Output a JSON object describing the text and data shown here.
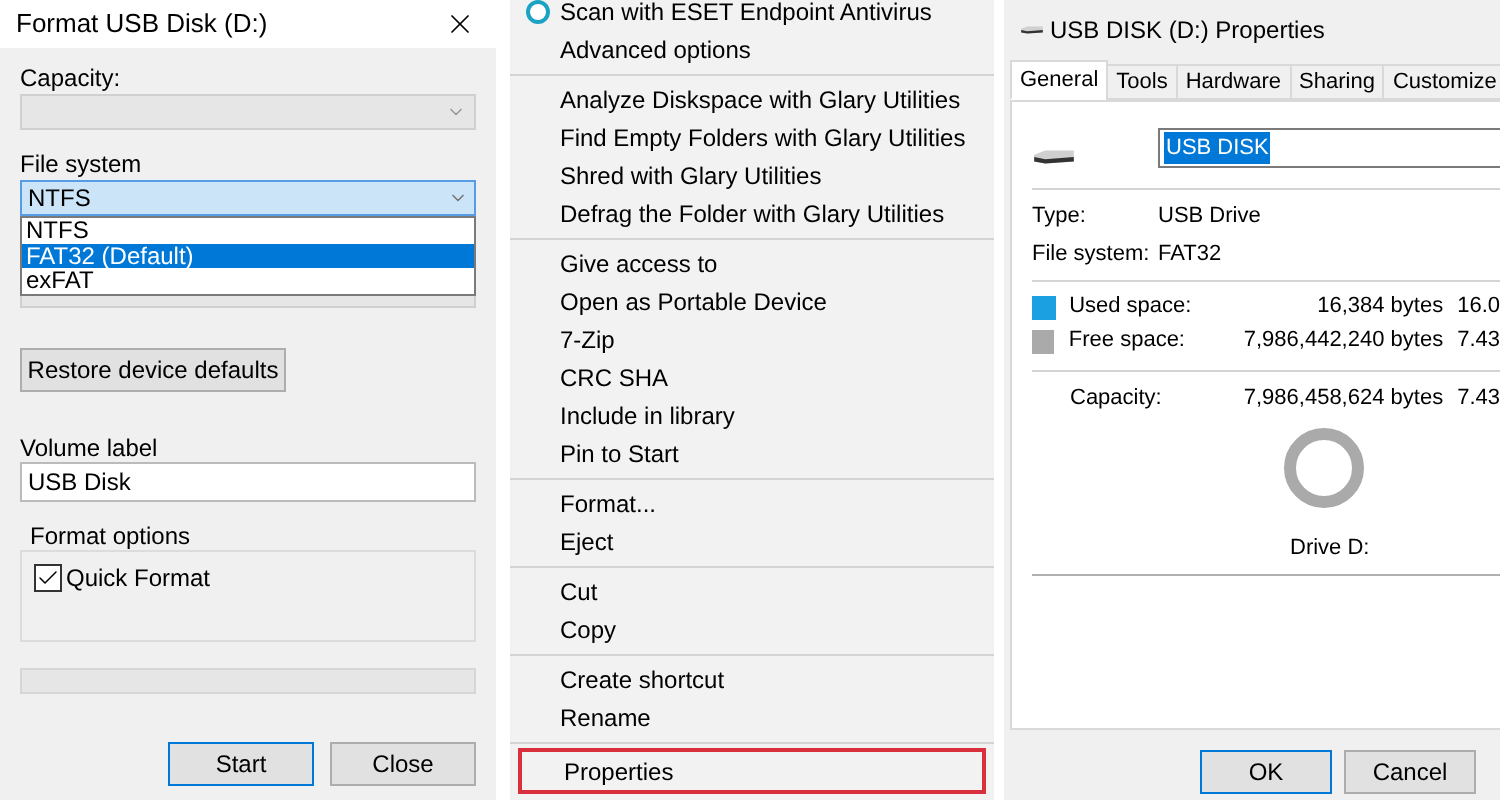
{
  "format_dialog": {
    "title": "Format USB Disk (D:)",
    "capacity_label": "Capacity:",
    "file_system_label": "File system",
    "file_system_value": "NTFS",
    "file_system_expanded": true,
    "file_system_options": [
      {
        "label": "NTFS",
        "selected": false
      },
      {
        "label": "FAT32 (Default)",
        "selected": true
      },
      {
        "label": "exFAT",
        "selected": false
      }
    ],
    "restore_button": "Restore device defaults",
    "volume_label_label": "Volume label",
    "volume_label_value": "USB Disk",
    "format_options_title": "Format options",
    "quick_format": {
      "label": "Quick Format",
      "checked": true
    },
    "progress": {
      "level": 0
    },
    "buttons": [
      {
        "label": "Start",
        "default": true
      },
      {
        "label": "Close",
        "default": false
      }
    ]
  },
  "context_menu": {
    "groups": [
      [
        {
          "label": "Scan with ESET Endpoint Antivirus",
          "icon": true,
          "selected": false
        },
        {
          "label": "Advanced options",
          "icon": false,
          "selected": false
        }
      ],
      [
        {
          "label": "Analyze Diskspace with Glary Utilities",
          "icon": false,
          "selected": false
        },
        {
          "label": "Find Empty Folders with Glary Utilities",
          "icon": false,
          "selected": false
        },
        {
          "label": "Shred with Glary Utilities",
          "icon": false,
          "selected": false
        },
        {
          "label": "Defrag the Folder with Glary Utilities",
          "icon": false,
          "selected": false
        }
      ],
      [
        {
          "label": "Give access to",
          "icon": false,
          "selected": false
        },
        {
          "label": "Open as Portable Device",
          "icon": false,
          "selected": false
        },
        {
          "label": "7-Zip",
          "icon": false,
          "selected": false
        },
        {
          "label": "CRC SHA",
          "icon": false,
          "selected": false
        },
        {
          "label": "Include in library",
          "icon": false,
          "selected": false
        },
        {
          "label": "Pin to Start",
          "icon": false,
          "selected": false
        }
      ],
      [
        {
          "label": "Format...",
          "icon": false,
          "selected": false
        },
        {
          "label": "Eject",
          "icon": false,
          "selected": false
        }
      ],
      [
        {
          "label": "Cut",
          "icon": false,
          "selected": false
        },
        {
          "label": "Copy",
          "icon": false,
          "selected": false
        }
      ],
      [
        {
          "label": "Create shortcut",
          "icon": false,
          "selected": false
        },
        {
          "label": "Rename",
          "icon": false,
          "selected": false
        }
      ],
      [
        {
          "label": "Properties",
          "icon": false,
          "selected": true
        }
      ]
    ]
  },
  "properties": {
    "title": "USB DISK (D:) Properties",
    "tabs": [
      {
        "label": "General",
        "selected": true
      },
      {
        "label": "Tools",
        "selected": false
      },
      {
        "label": "Hardware",
        "selected": false
      },
      {
        "label": "Sharing",
        "selected": false
      },
      {
        "label": "Customize",
        "selected": false
      }
    ],
    "name_value": "USB DISK",
    "name_selected": true,
    "info": [
      {
        "label": "Type:",
        "value": "USB Drive"
      },
      {
        "label": "File system:",
        "value": "FAT32"
      }
    ],
    "space": [
      {
        "label": "Used space:",
        "bytes": "16,384 bytes",
        "size": "16.0",
        "color": "#1ba1e2"
      },
      {
        "label": "Free space:",
        "bytes": "7,986,442,240 bytes",
        "size": "7.43",
        "color": "#aaaaaa"
      }
    ],
    "capacity": {
      "label": "Capacity:",
      "bytes": "7,986,458,624 bytes",
      "size": "7.43"
    },
    "drive_caption": "Drive D:",
    "buttons": [
      {
        "label": "OK",
        "default": true
      },
      {
        "label": "Cancel",
        "default": false
      }
    ]
  }
}
